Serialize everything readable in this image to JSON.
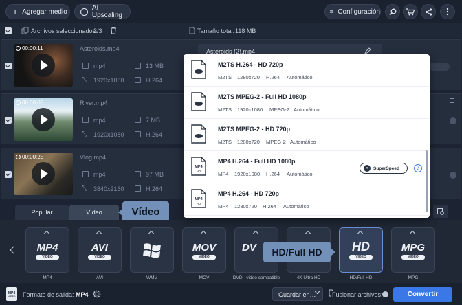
{
  "toolbar": {
    "add_media": "Agregar medio",
    "ai_upscaling": "AI Upscaling",
    "settings": "Configuración"
  },
  "selection": {
    "selected_label": "Archivos seleccionados:",
    "selected_count": "3/3",
    "total_label": "Tamaño total:",
    "total_size": "118 MB"
  },
  "files": [
    {
      "duration": "00:00:11",
      "name": "Asteroids.mp4",
      "format": "mp4",
      "size": "13 MB",
      "resolution": "1920x1080",
      "codec": "H.264"
    },
    {
      "duration": "00:00:05",
      "name": "River.mp4",
      "format": "mp4",
      "size": "7 MB",
      "resolution": "1920x1080",
      "codec": "H.264"
    },
    {
      "duration": "00:00:25",
      "name": "Vlog.mp4",
      "format": "mp4",
      "size": "97 MB",
      "resolution": "3840x2160",
      "codec": "H.264"
    }
  ],
  "output_card": {
    "name": "Asteroids (2).mp4"
  },
  "dropdown": {
    "options": [
      {
        "icon": "bluray-file-icon",
        "title": "M2TS H.264 - HD 720p",
        "specs": [
          "M2TS",
          "1280x720",
          "H.264",
          "Automático"
        ]
      },
      {
        "icon": "bluray-file-icon",
        "title": "M2TS MPEG-2 - Full HD 1080p",
        "specs": [
          "M2TS",
          "1920x1080",
          "MPEG-2",
          "Automático"
        ]
      },
      {
        "icon": "bluray-file-icon",
        "title": "M2TS MPEG-2 - HD 720p",
        "specs": [
          "M2TS",
          "1280x720",
          "MPEG-2",
          "Automático"
        ]
      },
      {
        "icon": "mp4-hd-file-icon",
        "icon_text": [
          "MP4",
          "HD"
        ],
        "title": "MP4 H.264 - Full HD 1080p",
        "specs": [
          "MP4",
          "1920x1080",
          "H.264",
          "Automático"
        ]
      },
      {
        "icon": "mp4-hd-file-icon",
        "icon_text": [
          "MP4",
          "HD"
        ],
        "title": "MP4 H.264 - HD 720p",
        "specs": [
          "MP4",
          "1280x720",
          "H.264",
          "Automático"
        ]
      }
    ],
    "superspeed": "SuperSpeed",
    "help": "?"
  },
  "tabs": {
    "popular": "Popular",
    "video": "Vídeo"
  },
  "tooltips": {
    "video": "Vídeo",
    "hd": "HD/Full HD"
  },
  "formats": [
    {
      "name": "MP4",
      "logo": "MP4",
      "sub": "VIDEO"
    },
    {
      "name": "AVI",
      "logo": "AVI",
      "sub": "VIDEO"
    },
    {
      "name": "WMV",
      "logo": ""
    },
    {
      "name": "MOV",
      "logo": "MOV",
      "sub": "VIDEO"
    },
    {
      "name": "DVD - video compatible",
      "logo": "DV"
    },
    {
      "name": "4K Ultra HD"
    },
    {
      "name": "HD/Full HD",
      "logo": "HD",
      "sub": "VIDEO"
    },
    {
      "name": "MPG",
      "logo": "MPG",
      "sub": "VIDEO"
    }
  ],
  "footer": {
    "output_label": "Formato de salida:",
    "output_value": "MP4",
    "save_in": "Guardar en…",
    "merge_label": "Fusionar archivos:",
    "convert": "Convertir",
    "mini_icon_text": [
      "MP4",
      "VIDEO"
    ]
  },
  "colors": {
    "accent": "#3b78e7",
    "tooltip": "#7390b8",
    "selected_border": "#6b8fd6"
  }
}
